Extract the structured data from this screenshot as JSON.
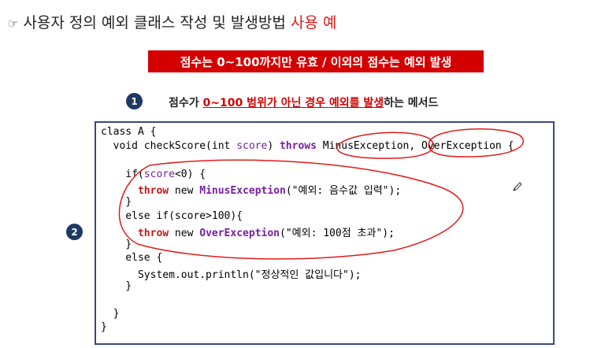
{
  "title": {
    "icon": "pointing-hand-icon",
    "icon_glyph": "☞",
    "main": "사용자 정의 예외 클래스 작성 및 발생방법 ",
    "accent": "사용 예",
    "accent_color": "#e01b1b"
  },
  "banner": {
    "text": "점수는 0~100까지만 유효 / 이외의 점수는 예외 발생",
    "color": "#d40000"
  },
  "step1": {
    "number": "1",
    "text_pre": "점수가 ",
    "text_red": "0~100 범위가 아닌 경우 예외를 발생",
    "text_post": "하는 메서드"
  },
  "step2": {
    "number": "2"
  },
  "code": {
    "l1": "class A {",
    "l2a": "  void checkScore(int ",
    "l2b": "score",
    "l2c": ") ",
    "l2d": "throws",
    "l2e": " MinusException, OverException {",
    "l4a": "    if(",
    "l4b": "score",
    "l4c": "<0) {",
    "l5a": "      ",
    "l5b": "throw",
    "l5c": " new ",
    "l5d": "MinusException",
    "l5e": "(\"예외: 음수값 입력\");",
    "l6": "    }",
    "l7": "    else if(score>100){",
    "l8a": "      ",
    "l8b": "throw",
    "l8c": " new ",
    "l8d": "OverException",
    "l8e": "(\"예외: 100점 초과\");",
    "l9": "    }",
    "l10": "    else {",
    "l11": "      System.out.println(\"정상적인 값입니다\");",
    "l12": "    }",
    "l14": "  }",
    "l15": "}"
  },
  "annotation_color": "#e01b1b"
}
